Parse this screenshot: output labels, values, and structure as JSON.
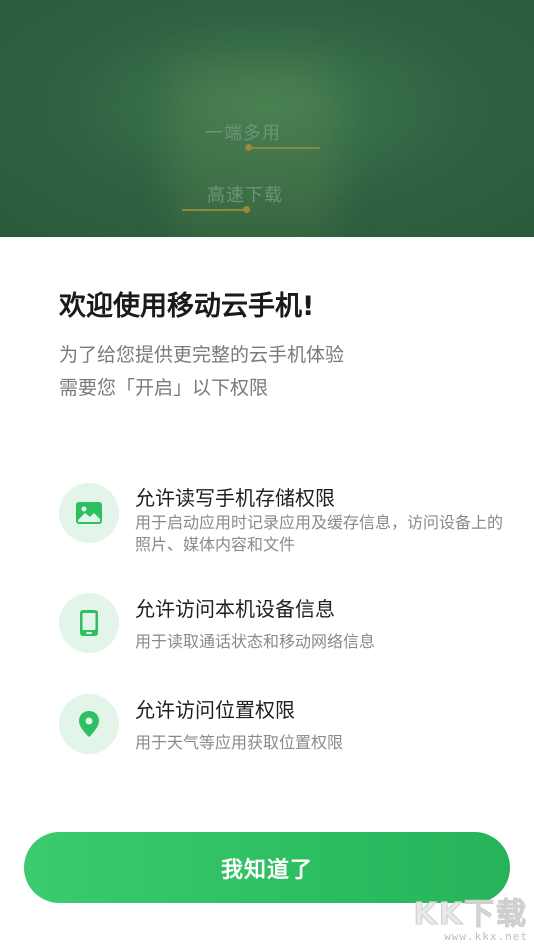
{
  "hero": {
    "feature_1": "一端多用",
    "feature_2": "高速下载"
  },
  "welcome": {
    "title": "欢迎使用移动云手机!",
    "subtitle_line_1": "为了给您提供更完整的云手机体验",
    "subtitle_line_2": "需要您「开启」以下权限"
  },
  "permissions": [
    {
      "icon": "image-icon",
      "title": "允许读写手机存储权限",
      "description": "用于启动应用时记录应用及缓存信息，访问设备上的照片、媒体内容和文件"
    },
    {
      "icon": "phone-device-icon",
      "title": "允许访问本机设备信息",
      "description": "用于读取通话状态和移动网络信息"
    },
    {
      "icon": "location-pin-icon",
      "title": "允许访问位置权限",
      "description": "用于天气等应用获取位置权限"
    }
  ],
  "confirm_button": {
    "label": "我知道了"
  },
  "watermark": {
    "logo": "KK下载",
    "url": "www.kkx.net"
  },
  "colors": {
    "accent": "#2dbf62",
    "icon_bg": "#e3f4e8",
    "hero_bg": "#2f6142"
  }
}
